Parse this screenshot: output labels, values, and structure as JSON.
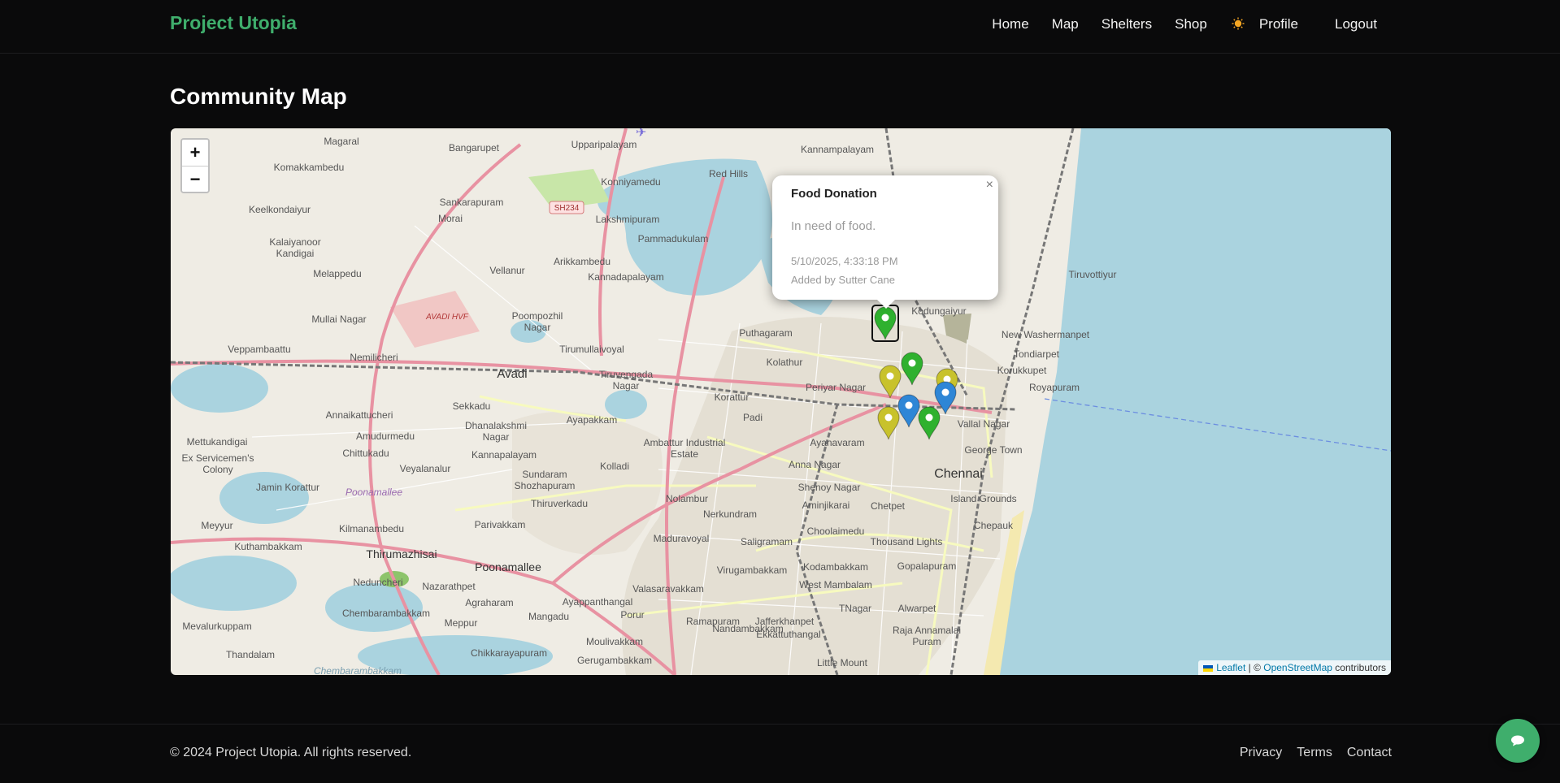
{
  "header": {
    "brand": "Project Utopia",
    "nav": {
      "home": "Home",
      "map": "Map",
      "shelters": "Shelters",
      "shop": "Shop",
      "theme_icon": "sun-icon",
      "profile": "Profile",
      "logout": "Logout"
    }
  },
  "page": {
    "title": "Community Map"
  },
  "map": {
    "zoom_in": "+",
    "zoom_out": "−",
    "popup": {
      "title": "Food Donation",
      "description": "In need of food.",
      "timestamp": "5/10/2025, 4:33:18 PM",
      "author": "Added by Sutter Cane",
      "close": "×"
    },
    "attribution": {
      "leaflet": "Leaflet",
      "separator": " | © ",
      "osm": "OpenStreetMap",
      "suffix": " contributors"
    },
    "marker_colors": {
      "green": "#2fb12f",
      "yellow": "#c8c22c",
      "blue": "#2e86d6"
    },
    "markers": [
      {
        "color": "green",
        "selected": true
      },
      {
        "color": "green",
        "selected": false
      },
      {
        "color": "yellow",
        "selected": false
      },
      {
        "color": "yellow",
        "selected": false
      },
      {
        "color": "blue",
        "selected": false
      },
      {
        "color": "blue",
        "selected": false
      },
      {
        "color": "yellow",
        "selected": false
      },
      {
        "color": "green",
        "selected": false
      }
    ],
    "place_labels": [
      "Magaral",
      "Bangarupet",
      "Upparipalayam",
      "Kannampalayam",
      "Komakkambedu",
      "Sankarapuram",
      "Konniyamedu",
      "Red Hills",
      "Keelkondaiyur",
      "Morai",
      "SH234",
      "Lakshmipuram",
      "Kalaiyanoor Kandigai",
      "Pammadukulam",
      "Melappedu",
      "Vellanur",
      "Arikkambedu",
      "Kannadapalayam",
      "Tiruvottiyur",
      "AVADI HVF",
      "Mullai Nagar",
      "Poompozhil Nagar",
      "Tirumullaivoyal",
      "Puthagaram",
      "Kodungaiyur",
      "New Washermanpet",
      "Veppambaattu",
      "Nemilicheri",
      "Tondiarpet",
      "Avadi",
      "Tiruvengada Nagar",
      "Kolathur",
      "Korukkupet",
      "Periyar Nagar",
      "Royapuram",
      "Sekkadu",
      "Korattur",
      "Annaikattucheri",
      "Dhanalakshmi Nagar",
      "Ayapakkam",
      "Vallal Nagar",
      "Mettukandigai",
      "Amudurmedu",
      "Ambattur Industrial Estate",
      "Ayanavaram",
      "George Town",
      "Ex Servicemen's Colony",
      "Chittukadu",
      "Kannapalayam",
      "Padi",
      "Anna Nagar",
      "Chennai",
      "Veyalanalur",
      "Kolladi",
      "Jamin Korattur",
      "Poonamallee",
      "Sundaram Shozhapuram",
      "Shenoy Nagar",
      "Island Grounds",
      "Thiruverkadu",
      "Aminjikarai",
      "Chetpet",
      "Nolambur",
      "Chepauk",
      "Meyyur",
      "Kilmanambedu",
      "Parivakkam",
      "Nerkundram",
      "Choolaimedu",
      "Kuthambakkam",
      "Thirumazhisai",
      "Maduravoyal",
      "Saligramam",
      "Thousand Lights",
      "Neduncheri",
      "Poonamallee",
      "Kodambakkam",
      "Gopalapuram",
      "Nazarathpet",
      "Virugambakkam",
      "West Mambalam",
      "Chembarambakkam",
      "Agraharam",
      "Valasaravakkam",
      "Meppur",
      "Mangadu",
      "Porur",
      "Ramapuram",
      "Jafferkhanpet",
      "TNagar",
      "Alwarpet",
      "Mevalurkuppam",
      "Ayappanthangal",
      "Ekkattuthangal",
      "Moulivakkam",
      "Raja Annamalai Puram",
      "Thandalam",
      "Chikkarayapuram",
      "Nandambakkam",
      "Gerugambakkam",
      "Little Mount",
      "Chembarambakkam"
    ]
  },
  "footer": {
    "copyright": "© 2024 Project Utopia. All rights reserved.",
    "links": {
      "privacy": "Privacy",
      "terms": "Terms",
      "contact": "Contact"
    },
    "chat_icon": "chat-bubble-icon"
  }
}
